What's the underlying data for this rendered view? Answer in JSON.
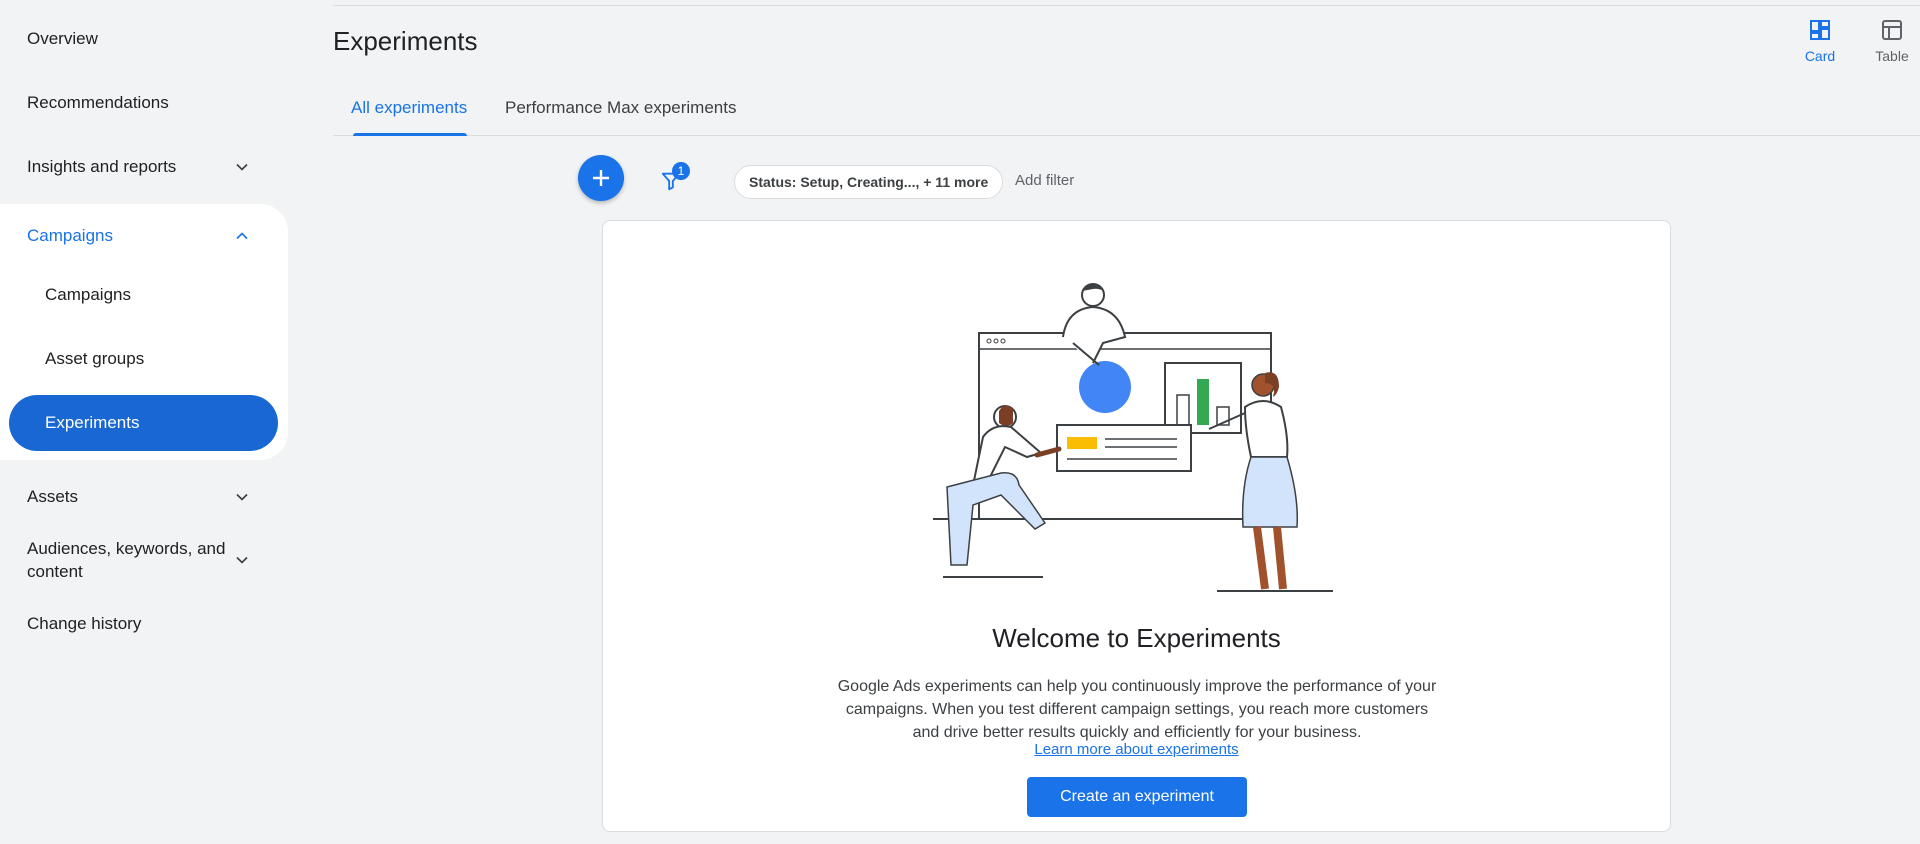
{
  "sidebar": {
    "overview": "Overview",
    "recommendations": "Recommendations",
    "insights": "Insights and reports",
    "campaigns_group": "Campaigns",
    "sub_items": [
      "Campaigns",
      "Asset groups",
      "Experiments"
    ],
    "assets": "Assets",
    "audiences_line1": "Audiences, keywords, and",
    "audiences_line2": "content",
    "change_history": "Change history"
  },
  "header": {
    "title": "Experiments",
    "view_card": "Card",
    "view_table": "Table"
  },
  "tabs": [
    "All experiments",
    "Performance Max experiments"
  ],
  "toolbar": {
    "filter_count": "1",
    "status_chip": "Status: Setup, Creating..., + 11 more",
    "add_filter": "Add filter"
  },
  "empty_state": {
    "title": "Welcome to Experiments",
    "description": "Google Ads experiments can help you continuously improve the performance of your campaigns. When you test different campaign settings, you reach more customers and drive better results quickly and efficiently for your business.",
    "learn_more": "Learn more about experiments",
    "create_button": "Create an experiment"
  },
  "colors": {
    "accent": "#1a73e8",
    "active_nav": "#1967d2",
    "background": "#f1f3f4"
  }
}
